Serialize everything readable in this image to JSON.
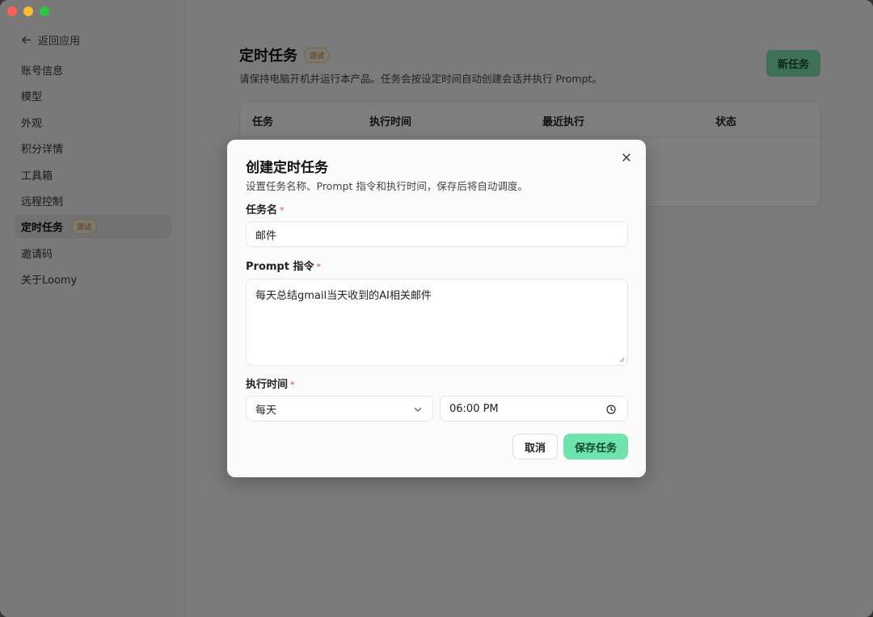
{
  "sidebar": {
    "back_label": "返回应用",
    "items": [
      {
        "label": "账号信息"
      },
      {
        "label": "模型"
      },
      {
        "label": "外观"
      },
      {
        "label": "积分详情"
      },
      {
        "label": "工具箱"
      },
      {
        "label": "远程控制"
      },
      {
        "label": "定时任务",
        "badge": "测试",
        "active": true
      },
      {
        "label": "邀请码"
      },
      {
        "label": "关于Loomy"
      }
    ]
  },
  "page": {
    "title": "定时任务",
    "badge": "测试",
    "subtitle": "请保持电脑开机并运行本产品。任务会按设定时间自动创建会话并执行 Prompt。",
    "new_button": "新任务",
    "columns": [
      "任务",
      "执行时间",
      "最近执行",
      "状态"
    ]
  },
  "modal": {
    "title": "创建定时任务",
    "description": "设置任务名称、Prompt 指令和执行时间，保存后将自动调度。",
    "name_label": "任务名",
    "name_value": "邮件",
    "prompt_label": "Prompt 指令",
    "prompt_value": "每天总结gmail当天收到的AI相关邮件",
    "time_label": "执行时间",
    "frequency_value": "每天",
    "time_value": "06:00 PM",
    "required_mark": "*",
    "cancel_label": "取消",
    "save_label": "保存任务"
  },
  "colors": {
    "accent": "#6ee3ad",
    "required": "#e5484d",
    "badge_text": "#b06b1f"
  }
}
